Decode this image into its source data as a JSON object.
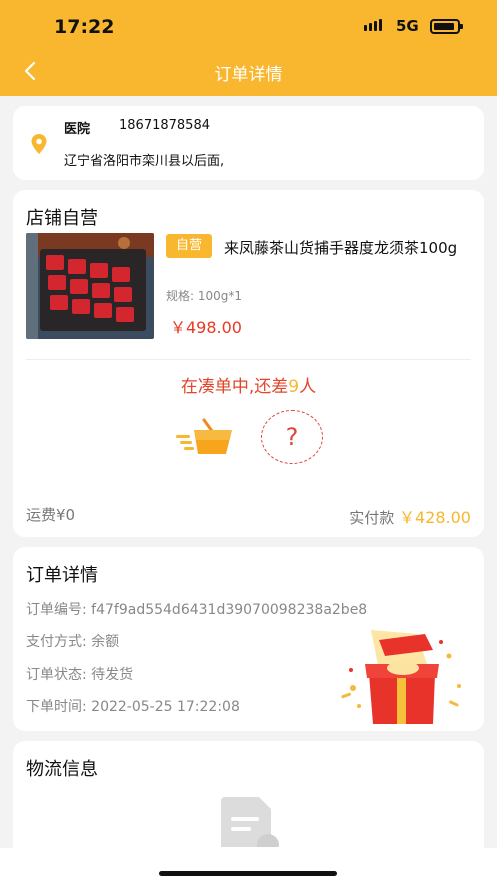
{
  "status_bar": {
    "time": "17:22",
    "network": "5G"
  },
  "header": {
    "title": "订单详情"
  },
  "address": {
    "name": "医院",
    "phone": "18671878584",
    "text": "辽宁省洛阳市栾川县以后面,"
  },
  "order": {
    "shop_name": "店铺自营",
    "product": {
      "tag": "自营",
      "name": "来凤藤茶山货捕手器度龙须茶100g",
      "spec": "规格:  100g*1",
      "price": "￥498.00"
    },
    "group": {
      "prefix": "在凑单中,还差",
      "count": "9",
      "suffix": "人",
      "slot_mark": "?"
    },
    "freight": "运费¥0",
    "paid_label": "实付款",
    "paid_amount": "￥428.00"
  },
  "details": {
    "title": "订单详情",
    "rows": [
      {
        "text": "订单编号:  f47f9ad554d6431d39070098238a2be8"
      },
      {
        "text": "支付方式:  余额"
      },
      {
        "text": "订单状态:  待发货"
      },
      {
        "text": "下单时间:  2022-05-25 17:22:08"
      }
    ]
  },
  "logistics": {
    "title": "物流信息"
  },
  "colors": {
    "accent": "#f8b72f",
    "price_red": "#e83a25",
    "background": "#f3f3f3"
  },
  "icons": [
    "back-icon",
    "location-pin-icon",
    "shopping-basket-icon",
    "gift-box-icon",
    "document-icon"
  ]
}
